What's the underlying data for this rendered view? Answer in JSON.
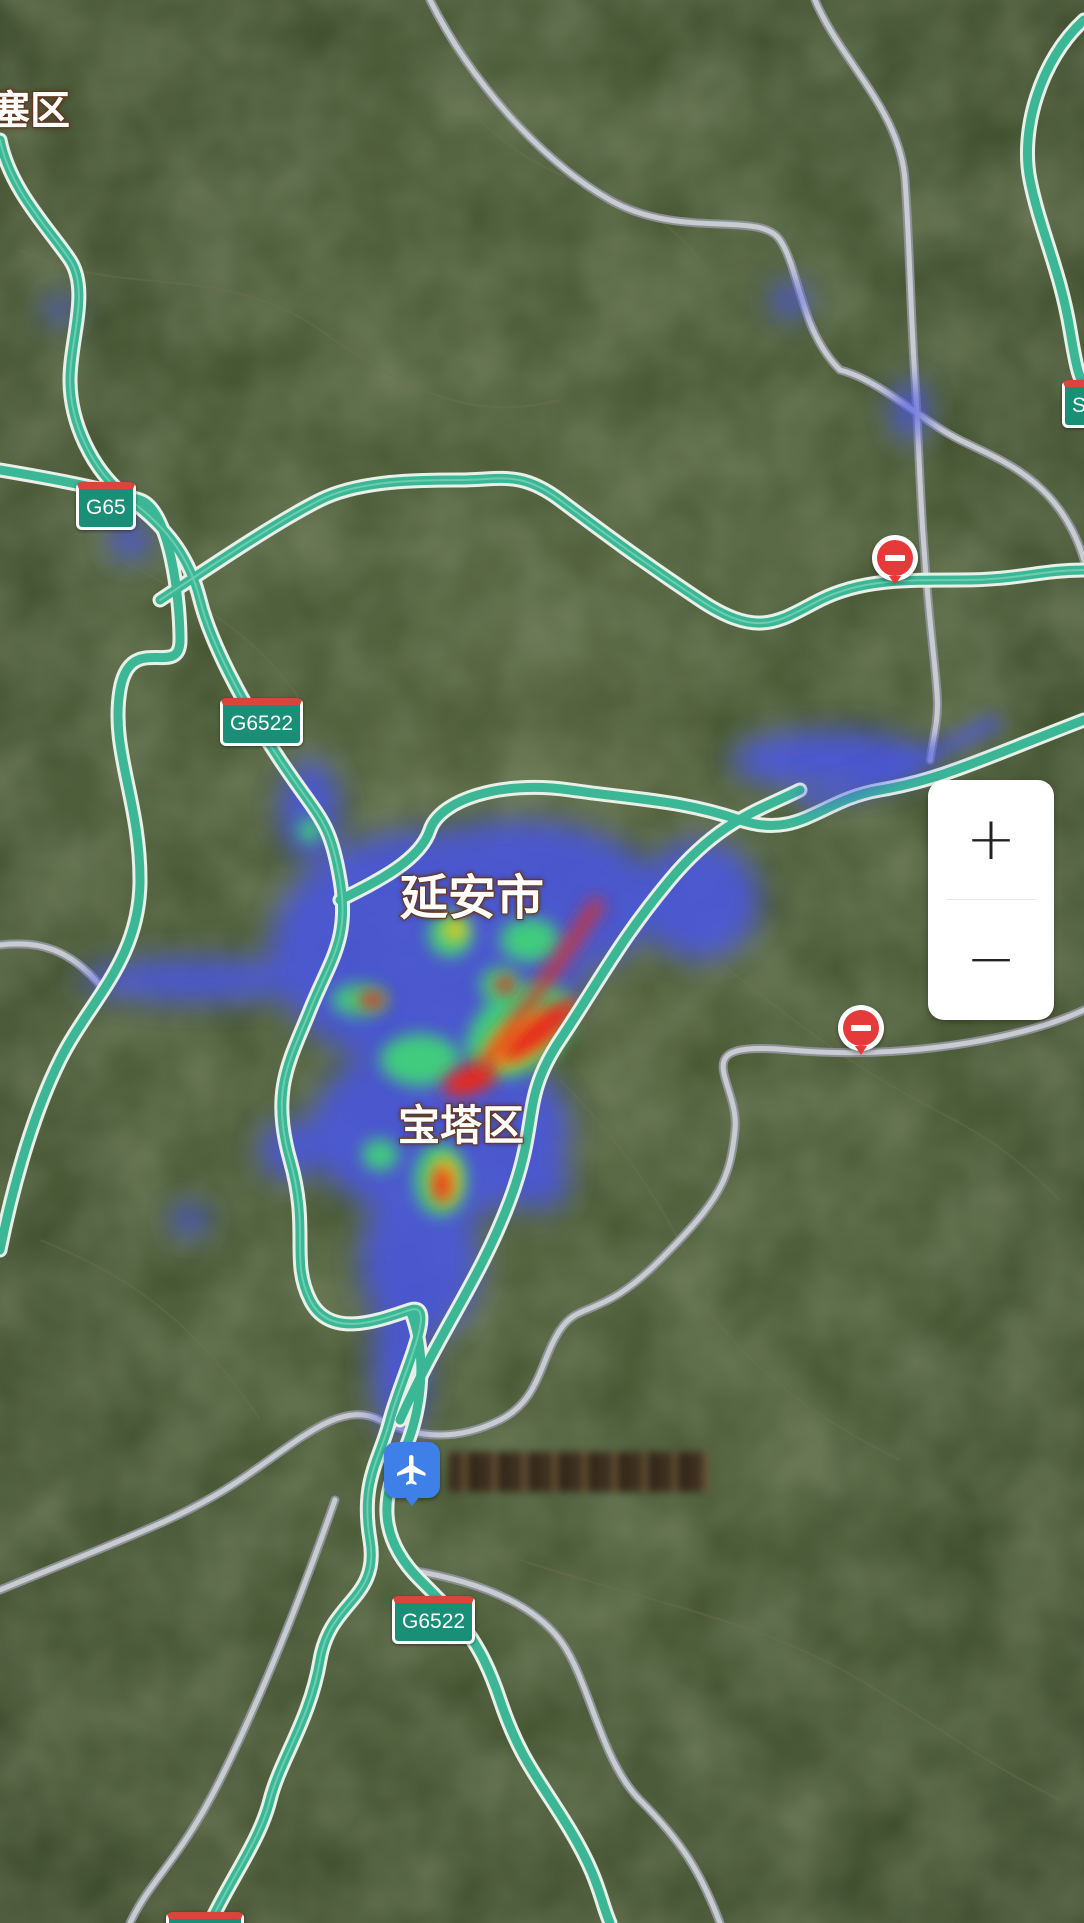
{
  "map": {
    "type": "satellite",
    "overlay": "heatmap",
    "colors": {
      "terrain": "#44532f",
      "expressway": "#3bb796",
      "expressway_edge": "#e8f0e8",
      "national_road": "#b8bcc4",
      "heat_low": "#4a55e6",
      "heat_mid": "#3fd27a",
      "heat_high": "#e82a1a",
      "label_halo": "#6b3b1d",
      "shield_bg": "#1a8f78",
      "shield_top": "#d9453a",
      "restriction": "#e5393a",
      "airport": "#3f7fe8"
    }
  },
  "labels": {
    "partial_district": "塞区",
    "city": "延安市",
    "district": "宝塔区"
  },
  "shields": {
    "g65": "G65",
    "g6522_north": "G6522",
    "g6522_south": "G6522",
    "s_edge": "S"
  },
  "markers": {
    "restriction_icon": "no-entry-icon",
    "airport_icon": "airplane-icon"
  },
  "zoom": {
    "in_label": "+",
    "out_label": "−"
  }
}
